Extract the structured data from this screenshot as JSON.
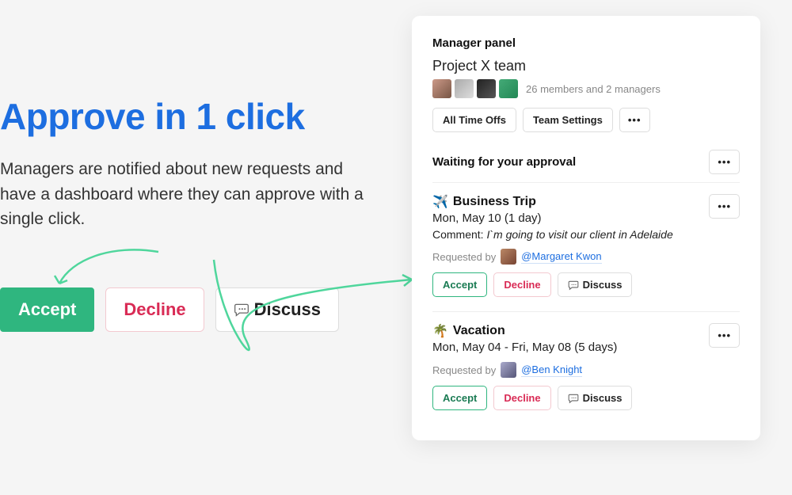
{
  "hero": {
    "headline": "Approve in 1 click",
    "subtext": "Managers are notified about new requests and have a dashboard where they can approve with a single click.",
    "accept": "Accept",
    "decline": "Decline",
    "discuss": "Discuss"
  },
  "panel": {
    "title": "Manager panel",
    "team": "Project X team",
    "member_count": "26 members and 2 managers",
    "all_timeoffs": "All Time Offs",
    "team_settings": "Team Settings",
    "more": "•••",
    "section_title": "Waiting for your approval",
    "section_more": "•••",
    "requests": [
      {
        "emoji": "✈️",
        "title": "Business Trip",
        "date": "Mon, May 10 (1 day)",
        "comment_label": "Comment:",
        "comment": "I`m going to visit our client in Adelaide",
        "requested_by_label": "Requested by",
        "requester": "@Margaret Kwon",
        "accept": "Accept",
        "decline": "Decline",
        "discuss": "Discuss",
        "more": "•••"
      },
      {
        "emoji": "🌴",
        "title": "Vacation",
        "date": "Mon, May 04 - Fri, May 08 (5 days)",
        "requested_by_label": "Requested by",
        "requester": "@Ben Knight",
        "accept": "Accept",
        "decline": "Decline",
        "discuss": "Discuss",
        "more": "•••"
      }
    ]
  }
}
